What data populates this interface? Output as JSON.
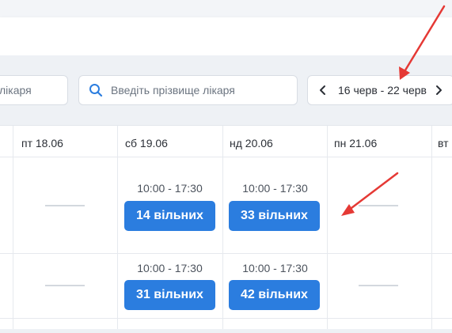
{
  "filters": {
    "specialty_placeholder": "лікаря",
    "doctor_placeholder": "Введіть прізвище лікаря",
    "week_range": "16 черв - 22 черв"
  },
  "days": [
    "пт 18.06",
    "сб 19.06",
    "нд 20.06",
    "пн 21.06",
    "вт"
  ],
  "rows": [
    {
      "sat": {
        "time": "10:00 - 17:30",
        "slots": "14 вільних"
      },
      "sun": {
        "time": "10:00 - 17:30",
        "slots": "33 вільних"
      }
    },
    {
      "sat": {
        "time": "10:00 - 17:30",
        "slots": "31 вільних"
      },
      "sun": {
        "time": "10:00 - 17:30",
        "slots": "42 вільних"
      }
    }
  ],
  "colors": {
    "accent": "#2b7ddf",
    "annotation": "#e53935"
  }
}
